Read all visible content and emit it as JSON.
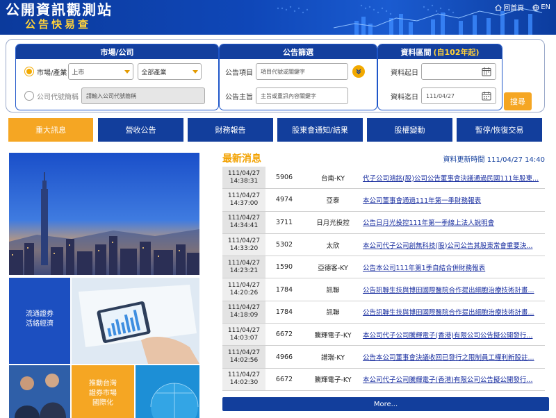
{
  "header": {
    "title": "公開資訊觀測站",
    "subtitle": "公告快易查",
    "links": {
      "home": "回首頁",
      "lang": "EN"
    }
  },
  "search": {
    "market_box": {
      "heading": "市場/公司",
      "market_label": "市場/產業",
      "market_select": "上市",
      "industry_select": "全部產業",
      "company_label": "公司代號簡稱",
      "company_placeholder": "請輸入公司代號簡稱"
    },
    "filter_box": {
      "heading": "公告篩選",
      "item_label": "公告項目",
      "item_placeholder": "項目代號或關鍵字",
      "subject_label": "公告主旨",
      "subject_placeholder": "主旨或重訊內容關鍵字"
    },
    "date_box": {
      "heading": "資料區間",
      "heading_note": "(自102年起)",
      "start_label": "資料起日",
      "start_value": "",
      "end_label": "資料迄日",
      "end_value": "111/04/27"
    },
    "query_button": "搜尋"
  },
  "nav": {
    "tabs": [
      "重大訊息",
      "營收公告",
      "財務報告",
      "股東會通知/結果",
      "股權變動",
      "暫停/恢復交易"
    ]
  },
  "promo": {
    "tile_bond": "流通證券\n活絡經濟",
    "tile_market": "推動台灣\n證券市場\n國際化"
  },
  "news": {
    "title": "最新消息",
    "updated": "資料更新時間 111/04/27 14:40",
    "rows": [
      {
        "date": "111/04/27",
        "time": "14:38:31",
        "code": "5906",
        "name": "台南-KY",
        "subject": "代子公司鴻銘(股)公司公告董事會決議通過民國111年股東..."
      },
      {
        "date": "111/04/27",
        "time": "14:37:00",
        "code": "4974",
        "name": "亞泰",
        "subject": "本公司董事會通過111年第一季財務報表"
      },
      {
        "date": "111/04/27",
        "time": "14:34:41",
        "code": "3711",
        "name": "日月光投控",
        "subject": "公告日月光投控111年第一季線上法人說明會"
      },
      {
        "date": "111/04/27",
        "time": "14:33:20",
        "code": "5302",
        "name": "太欣",
        "subject": "本公司代子公司創無科技(股)公司公告其股東常會重要決..."
      },
      {
        "date": "111/04/27",
        "time": "14:23:21",
        "code": "1590",
        "name": "亞德客-KY",
        "subject": "公告本公司111年第1季自結合併財務報表"
      },
      {
        "date": "111/04/27",
        "time": "14:20:26",
        "code": "1784",
        "name": "訊聯",
        "subject": "公告訊聯生技與博田國際醫院合作提出細胞治療技術計畫..."
      },
      {
        "date": "111/04/27",
        "time": "14:18:09",
        "code": "1784",
        "name": "訊聯",
        "subject": "公告訊聯生技與博田國際醫院合作提出細胞治療技術計畫..."
      },
      {
        "date": "111/04/27",
        "time": "14:03:07",
        "code": "6672",
        "name": "騰輝電子-KY",
        "subject": "本公司代子公司騰輝電子(香港)有限公司公告擬公開發行..."
      },
      {
        "date": "111/04/27",
        "time": "14:02:56",
        "code": "4966",
        "name": "譜瑞-KY",
        "subject": "公告本公司董事會決議收回已發行之限制員工權利新股註..."
      },
      {
        "date": "111/04/27",
        "time": "14:02:30",
        "code": "6672",
        "name": "騰輝電子-KY",
        "subject": "本公司代子公司騰輝電子(香港)有限公司公告擬公開發行..."
      }
    ],
    "more": "More..."
  },
  "colors": {
    "navy": "#123e9c",
    "accent": "#f5a623",
    "link": "#1a2fa0"
  }
}
